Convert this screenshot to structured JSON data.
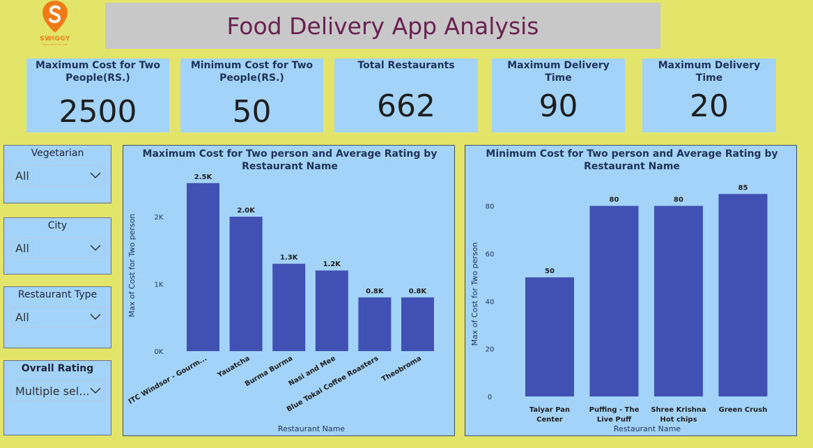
{
  "brand": {
    "name": "SWIGGY",
    "tagline": "FOOD DELIVERY APP",
    "color": "#f07a16"
  },
  "header": {
    "title": "Food Delivery App Analysis"
  },
  "kpis": [
    {
      "label": "Maximum Cost for Two People(RS.)",
      "value": "2500"
    },
    {
      "label": "Minimum Cost for Two People(RS.)",
      "value": "50"
    },
    {
      "label": "Total Restaurants",
      "value": "662"
    },
    {
      "label": "Maximum Delivery Time",
      "value": "90"
    },
    {
      "label": "Maximum Delivery Time",
      "value": "20"
    }
  ],
  "slicers": [
    {
      "label": "Vegetarian",
      "value": "All"
    },
    {
      "label": "City",
      "value": "All"
    },
    {
      "label": "Restaurant Type",
      "value": "All"
    },
    {
      "label": "Ovrall Rating",
      "value": "Multiple sel..."
    }
  ],
  "colors": {
    "bar": "#4150b3",
    "panel": "#a3d3f8",
    "background": "#e3e56a",
    "title": "#6a2050"
  },
  "chart_data": [
    {
      "type": "bar",
      "title": "Maximum Cost for Two person and Average Rating by Restaurant Name",
      "xlabel": "Restaurant Name",
      "ylabel": "Max of Cost for Two person",
      "categories": [
        "ITC Windsor - Gourm...",
        "Yauatcha",
        "Burma Burma",
        "Nasi and Mee",
        "Blue Tokai Coffee Roasters",
        "Theobroma"
      ],
      "values": [
        2500,
        2000,
        1300,
        1200,
        800,
        800
      ],
      "data_labels": [
        "2.5K",
        "2.0K",
        "1.3K",
        "1.2K",
        "0.8K",
        "0.8K"
      ],
      "yticks": [
        0,
        1000,
        2000
      ],
      "ytick_labels": [
        "0K",
        "1K",
        "2K"
      ],
      "ylim": [
        0,
        2550
      ],
      "grid": false
    },
    {
      "type": "bar",
      "title": "Minimum Cost for Two person and Average Rating by Restaurant Name",
      "xlabel": "Restaurant Name",
      "ylabel": "Max of Cost for Two person",
      "categories": [
        "Taiyar Pan Center",
        "Puffing - The Live Puff",
        "Shree Krishna Hot chips",
        "Green Crush"
      ],
      "values": [
        50,
        80,
        80,
        85
      ],
      "data_labels": [
        "50",
        "80",
        "80",
        "85"
      ],
      "yticks": [
        0,
        20,
        40,
        60,
        80
      ],
      "ytick_labels": [
        "0",
        "20",
        "40",
        "60",
        "80"
      ],
      "ylim": [
        0,
        86
      ],
      "grid": false
    }
  ]
}
